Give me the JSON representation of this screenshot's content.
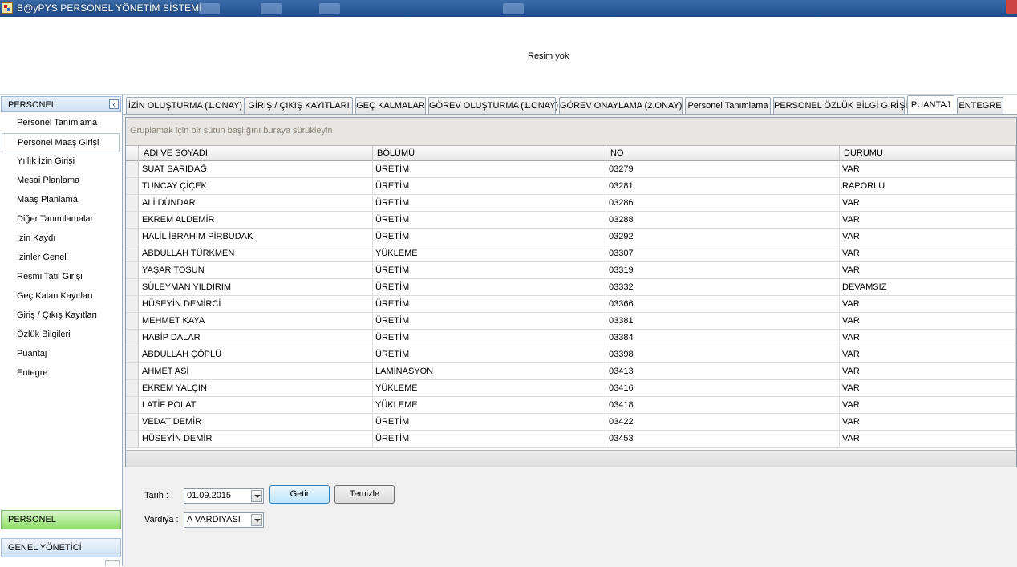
{
  "window": {
    "title": "B@yPYS PERSONEL YÖNETİM SİSTEMİ"
  },
  "banner": {
    "image_placeholder": "Resim yok"
  },
  "sidebar": {
    "header": "PERSONEL",
    "collapse_glyph": "‹",
    "items": [
      "Personel Tanımlama",
      "Personel Maaş Girişi",
      "Yıllık İzin Girişi",
      "Mesai Planlama",
      "Maaş Planlama",
      "Diğer Tanımlamalar",
      "İzin Kaydı",
      "İzinler Genel",
      "Resmi Tatil Girişi",
      "Geç Kalan Kayıtları",
      "Giriş / Çıkış Kayıtları",
      "Özlük Bilgileri",
      "Puantaj",
      "Entegre"
    ],
    "selected_index": 1,
    "groups": [
      "PERSONEL",
      "GENEL YÖNETİCİ"
    ]
  },
  "tabs": [
    "İZİN OLUŞTURMA (1.ONAY)",
    "GİRİŞ / ÇIKIŞ KAYITLARI",
    "GEÇ KALMALAR",
    "GÖREV OLUŞTURMA (1.ONAY)",
    "GÖREV ONAYLAMA (2.ONAY)",
    "Personel Tanımlama",
    "PERSONEL ÖZLÜK BİLGİ GİRİŞİ",
    "PUANTAJ",
    "ENTEGRE"
  ],
  "active_tab_index": 7,
  "grid": {
    "group_panel_text": "Gruplamak için bir sütun başlığını buraya sürükleyin",
    "columns": [
      "ADI VE SOYADI",
      "BÖLÜMÜ",
      "NO",
      "DURUMU"
    ],
    "rows": [
      [
        "SUAT SARIDAĞ",
        "ÜRETİM",
        "03279",
        "VAR"
      ],
      [
        "TUNCAY ÇİÇEK",
        "ÜRETİM",
        "03281",
        "RAPORLU"
      ],
      [
        "ALİ DÜNDAR",
        "ÜRETİM",
        "03286",
        "VAR"
      ],
      [
        "EKREM ALDEMİR",
        "ÜRETİM",
        "03288",
        "VAR"
      ],
      [
        "HALİL İBRAHİM PİRBUDAK",
        "ÜRETİM",
        "03292",
        "VAR"
      ],
      [
        "ABDULLAH TÜRKMEN",
        "YÜKLEME",
        "03307",
        "VAR"
      ],
      [
        "YAŞAR TOSUN",
        "ÜRETİM",
        "03319",
        "VAR"
      ],
      [
        "SÜLEYMAN YILDIRIM",
        "ÜRETİM",
        "03332",
        "DEVAMSIZ"
      ],
      [
        "HÜSEYİN DEMİRCİ",
        "ÜRETİM",
        "03366",
        "VAR"
      ],
      [
        "MEHMET KAYA",
        "ÜRETİM",
        "03381",
        "VAR"
      ],
      [
        "HABİP DALAR",
        "ÜRETİM",
        "03384",
        "VAR"
      ],
      [
        "ABDULLAH ÇÖPLÜ",
        "ÜRETİM",
        "03398",
        "VAR"
      ],
      [
        "AHMET ASİ",
        "LAMİNASYON",
        "03413",
        "VAR"
      ],
      [
        "EKREM YALÇIN",
        "YÜKLEME",
        "03416",
        "VAR"
      ],
      [
        "LATİF POLAT",
        "YÜKLEME",
        "03418",
        "VAR"
      ],
      [
        "VEDAT DEMİR",
        "ÜRETİM",
        "03422",
        "VAR"
      ],
      [
        "HÜSEYİN DEMİR",
        "ÜRETİM",
        "03453",
        "VAR"
      ]
    ]
  },
  "form": {
    "date_label": "Tarih :",
    "date_value": "01.09.2015",
    "get_button": "Getir",
    "clear_button": "Temizle",
    "shift_label": "Vardiya :",
    "shift_value": "A VARDIYASI"
  }
}
